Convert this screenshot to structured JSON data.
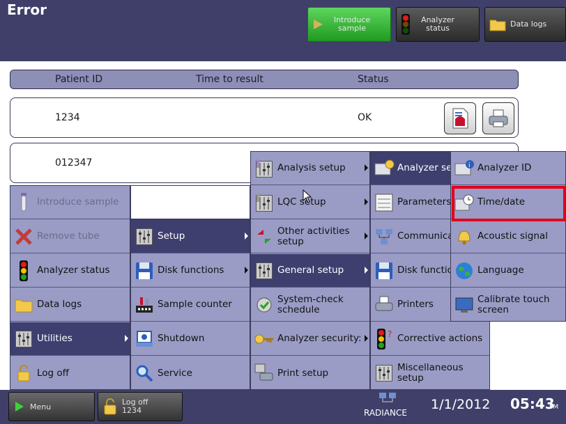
{
  "header": {
    "title": "Error",
    "buttons": {
      "introduce_sample": "Introduce sample",
      "analyzer_status": "Analyzer status",
      "data_logs": "Data logs"
    }
  },
  "table": {
    "columns": [
      "Patient ID",
      "Time to result",
      "Status"
    ],
    "rows": [
      {
        "patient_id": "1234",
        "status": "OK"
      },
      {
        "patient_id": "012347",
        "status": ""
      }
    ]
  },
  "menu1": {
    "items": [
      {
        "label": "Introduce sample",
        "icon": "tube-icon",
        "disabled": true
      },
      {
        "label": "Remove tube",
        "icon": "remove-x-icon",
        "disabled": true
      },
      {
        "label": "Analyzer status",
        "icon": "traffic-light-icon"
      },
      {
        "label": "Data logs",
        "icon": "folder-icon"
      },
      {
        "label": "Utilities",
        "icon": "sliders-icon",
        "selected": true,
        "submenu": true
      },
      {
        "label": "Log off",
        "icon": "padlock-icon"
      }
    ]
  },
  "menu2": {
    "items": [
      {
        "label": "Setup",
        "icon": "sliders-icon",
        "selected": true,
        "submenu": true
      },
      {
        "label": "Disk functions",
        "icon": "floppy-disk-icon",
        "submenu": true
      },
      {
        "label": "Sample counter",
        "icon": "counter-icon"
      },
      {
        "label": "Shutdown",
        "icon": "shutdown-icon"
      },
      {
        "label": "Service",
        "icon": "magnifier-icon"
      }
    ]
  },
  "menu3": {
    "items": [
      {
        "label": "Analysis setup",
        "icon": "sliders-icon",
        "submenu": true
      },
      {
        "label": "LQC setup",
        "icon": "sliders-icon",
        "submenu": true
      },
      {
        "label": "Other activities setup",
        "icon": "arrows-icon",
        "submenu": true
      },
      {
        "label": "General setup",
        "icon": "sliders-icon",
        "selected": true,
        "submenu": true
      },
      {
        "label": "System-check schedule",
        "icon": "system-check-icon"
      },
      {
        "label": "Analyzer security:",
        "icon": "keys-icon",
        "submenu": true
      },
      {
        "label": "Print setup",
        "icon": "print-setup-icon"
      }
    ]
  },
  "menu4": {
    "items": [
      {
        "label": "Analyzer se",
        "icon": "analyzer-icon",
        "selected": true,
        "submenu": true
      },
      {
        "label": "Parameters input",
        "icon": "parameters-icon"
      },
      {
        "label": "Communica",
        "icon": "network-icon"
      },
      {
        "label": "Disk functio",
        "icon": "floppy-disk-icon"
      },
      {
        "label": "Printers",
        "icon": "printer-icon"
      },
      {
        "label": "Corrective actions",
        "icon": "traffic-question-icon"
      },
      {
        "label": "Miscellaneous setup",
        "icon": "sliders-icon"
      }
    ]
  },
  "menu5": {
    "items": [
      {
        "label": "Analyzer ID",
        "icon": "analyzer-id-icon"
      },
      {
        "label": "Time/date",
        "icon": "clock-icon",
        "highlighted": true
      },
      {
        "label": "Acoustic signal",
        "icon": "bell-icon"
      },
      {
        "label": "Language",
        "icon": "globe-icon"
      },
      {
        "label": "Calibrate touch screen",
        "icon": "touch-screen-icon"
      }
    ]
  },
  "bottom": {
    "menu_label": "Menu",
    "logoff_label": "Log off",
    "logoff_user": "1234",
    "brand": "RADIANCE",
    "date": "1/1/2012",
    "time": "05:43",
    "ampm": "PM"
  },
  "colors": {
    "header_bg": "#3f3f6a",
    "menu_bg": "#9a9cc6",
    "menu_selected": "#3e3f6f",
    "highlight": "#e3001b",
    "introduce_green": "#2fb82f"
  }
}
